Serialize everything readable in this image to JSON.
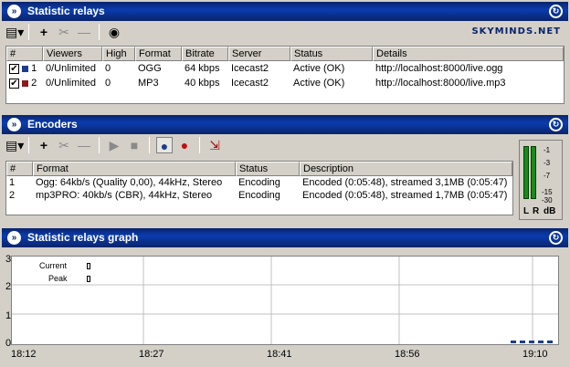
{
  "relays": {
    "title": "Statistic relays",
    "brand": "SKYMINDS.NET",
    "columns": [
      "#",
      "Viewers",
      "High",
      "Format",
      "Bitrate",
      "Server",
      "Status",
      "Details"
    ],
    "rows": [
      {
        "num": "1",
        "viewers": "0/Unlimited",
        "high": "0",
        "format": "OGG",
        "bitrate": "64 kbps",
        "server": "Icecast2",
        "status": "Active (OK)",
        "details": "http://localhost:8000/live.ogg",
        "color": "#1c3c8c"
      },
      {
        "num": "2",
        "viewers": "0/Unlimited",
        "high": "0",
        "format": "MP3",
        "bitrate": "40 kbps",
        "server": "Icecast2",
        "status": "Active (OK)",
        "details": "http://localhost:8000/live.mp3",
        "color": "#8c1c1c"
      }
    ]
  },
  "encoders": {
    "title": "Encoders",
    "columns": [
      "#",
      "Format",
      "Status",
      "Description"
    ],
    "rows": [
      {
        "num": "1",
        "format": "Ogg: 64kb/s (Quality 0,00), 44kHz, Stereo",
        "status": "Encoding",
        "description": "Encoded (0:05:48), streamed 3,1MB (0:05:47)"
      },
      {
        "num": "2",
        "format": "mp3PRO: 40kb/s (CBR), 44kHz, Stereo",
        "status": "Encoding",
        "description": "Encoded (0:05:48), streamed 1,7MB (0:05:47)"
      }
    ],
    "vu_scale": [
      "-1",
      "-3",
      "-7",
      "-15",
      "-30"
    ],
    "vu_labels": [
      "L",
      "R",
      "dB"
    ]
  },
  "graph": {
    "title": "Statistic relays graph",
    "legend": [
      "Current",
      "Peak"
    ],
    "y_ticks": [
      "3",
      "2",
      "1",
      "0"
    ],
    "x_ticks": [
      "18:12",
      "18:27",
      "18:41",
      "18:56",
      "19:10"
    ]
  }
}
